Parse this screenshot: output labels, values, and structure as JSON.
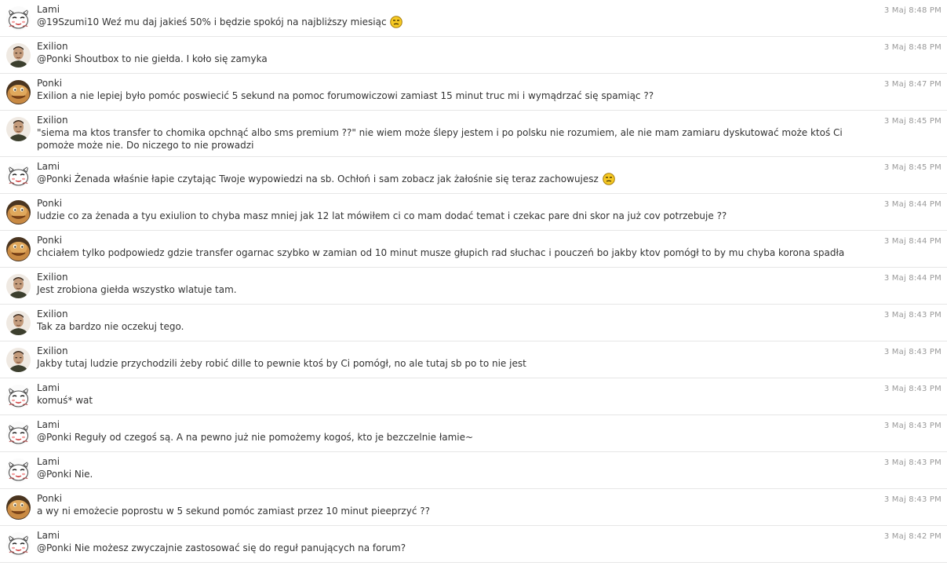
{
  "messages": [
    {
      "author": "Lami",
      "avatar": "lami-avatar",
      "time": "3 Maj 8:48 PM",
      "text": "@19Szumi10 Weź mu daj jakieś 50% i będzie spokój na najbliższy miesiąc",
      "emoji": "smirk-emoji"
    },
    {
      "author": "Exilion",
      "avatar": "exilion-avatar",
      "time": "3 Maj 8:48 PM",
      "text": "@Ponki Shoutbox to nie giełda. I koło się zamyka",
      "emoji": ""
    },
    {
      "author": "Ponki",
      "avatar": "ponki-avatar",
      "time": "3 Maj 8:47 PM",
      "text": "Exilion a nie lepiej było pomóc poswiecić 5 sekund na pomoc forumowiczowi zamiast 15 minut truc mi i wymądrzać się spamiąc ??",
      "emoji": ""
    },
    {
      "author": "Exilion",
      "avatar": "exilion-avatar",
      "time": "3 Maj 8:45 PM",
      "text": "\"siema ma ktos transfer to chomika opchnąć albo sms premium ??\" nie wiem może ślepy jestem i po polsku nie rozumiem, ale nie mam zamiaru dyskutować może ktoś Ci pomoże może nie. Do niczego to nie prowadzi",
      "emoji": ""
    },
    {
      "author": "Lami",
      "avatar": "lami-avatar",
      "time": "3 Maj 8:45 PM",
      "text": "@Ponki Żenada właśnie łapie czytając Twoje wypowiedzi na sb. Ochłoń i sam zobacz jak żałośnie się teraz zachowujesz",
      "emoji": "smirk-emoji"
    },
    {
      "author": "Ponki",
      "avatar": "ponki-avatar",
      "time": "3 Maj 8:44 PM",
      "text": "ludzie co za żenada a tyu exiulion to chyba masz mniej jak 12 lat mówiłem ci co mam dodać temat i czekac pare dni skor na już cov potrzebuje ??",
      "emoji": ""
    },
    {
      "author": "Ponki",
      "avatar": "ponki-avatar",
      "time": "3 Maj 8:44 PM",
      "text": "chciałem tylko podpowiedz gdzie transfer ogarnac szybko w zamian od 10 minut musze głupich rad słuchac i pouczeń bo jakby ktov pomógł to by mu chyba korona spadła",
      "emoji": ""
    },
    {
      "author": "Exilion",
      "avatar": "exilion-avatar",
      "time": "3 Maj 8:44 PM",
      "text": "Jest zrobiona giełda wszystko wlatuje tam.",
      "emoji": ""
    },
    {
      "author": "Exilion",
      "avatar": "exilion-avatar",
      "time": "3 Maj 8:43 PM",
      "text": "Tak za bardzo nie oczekuj tego.",
      "emoji": ""
    },
    {
      "author": "Exilion",
      "avatar": "exilion-avatar",
      "time": "3 Maj 8:43 PM",
      "text": "Jakby tutaj ludzie przychodzili żeby robić dille to pewnie ktoś by Ci pomógł, no ale tutaj sb po to nie jest",
      "emoji": ""
    },
    {
      "author": "Lami",
      "avatar": "lami-avatar",
      "time": "3 Maj 8:43 PM",
      "text": "komuś* wat",
      "emoji": ""
    },
    {
      "author": "Lami",
      "avatar": "lami-avatar",
      "time": "3 Maj 8:43 PM",
      "text": "@Ponki Reguły od czegoś są. A na pewno już nie pomożemy kogoś, kto je bezczelnie łamie~",
      "emoji": ""
    },
    {
      "author": "Lami",
      "avatar": "lami-avatar",
      "time": "3 Maj 8:43 PM",
      "text": "@Ponki Nie.",
      "emoji": ""
    },
    {
      "author": "Ponki",
      "avatar": "ponki-avatar",
      "time": "3 Maj 8:43 PM",
      "text": "a wy ni emożecie poprostu w 5 sekund pomóc zamiast przez 10 minut pieeprzyć ??",
      "emoji": ""
    },
    {
      "author": "Lami",
      "avatar": "lami-avatar",
      "time": "3 Maj 8:42 PM",
      "text": "@Ponki Nie możesz zwyczajnie zastosować się do reguł panujących na forum?",
      "emoji": ""
    }
  ]
}
